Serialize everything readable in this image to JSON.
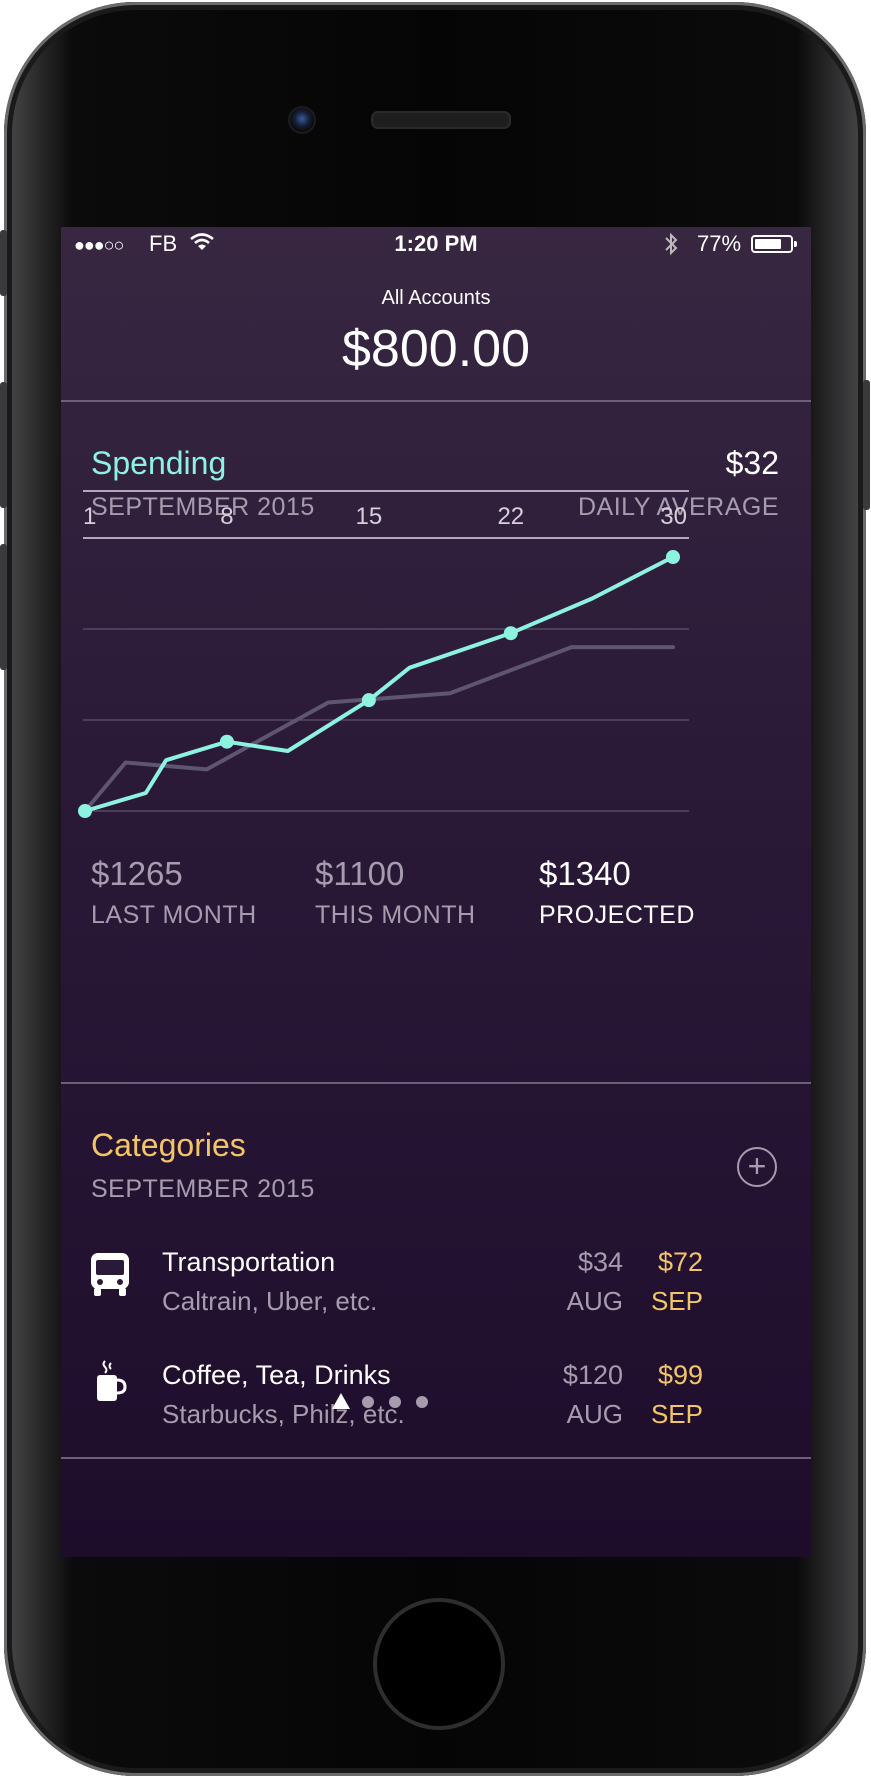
{
  "status_bar": {
    "signal": "●●●○○",
    "carrier": "FB",
    "time": "1:20 PM",
    "battery_percent": "77%",
    "battery_level": 0.77
  },
  "header": {
    "label": "All Accounts",
    "balance": "$800.00"
  },
  "spending": {
    "title": "Spending",
    "period": "SEPTEMBER 2015",
    "daily_average_value": "$32",
    "daily_average_label": "DAILY AVERAGE"
  },
  "chart_data": {
    "type": "line",
    "x_ticks": [
      "1",
      "8",
      "15",
      "22",
      "30"
    ],
    "xlim": [
      1,
      30
    ],
    "grid": true,
    "series": [
      {
        "color": "#8ef2e1",
        "points": [
          [
            1,
            0
          ],
          [
            4,
            78
          ],
          [
            5,
            220
          ],
          [
            8,
            300
          ],
          [
            11,
            260
          ],
          [
            15,
            480
          ],
          [
            17,
            620
          ],
          [
            22,
            770
          ],
          [
            26,
            920
          ],
          [
            30,
            1100
          ]
        ],
        "markers": [
          1,
          8,
          15,
          22,
          30
        ]
      },
      {
        "color": "#5e5670",
        "points": [
          [
            1,
            0
          ],
          [
            3,
            210
          ],
          [
            7,
            180
          ],
          [
            13,
            470
          ],
          [
            19,
            510
          ],
          [
            25,
            710
          ],
          [
            30,
            710
          ]
        ],
        "markers": []
      }
    ],
    "ylim": [
      0,
      1100
    ]
  },
  "summary": [
    {
      "value": "$1265",
      "label": "LAST MONTH",
      "highlight": false
    },
    {
      "value": "$1100",
      "label": "THIS MONTH",
      "highlight": false
    },
    {
      "value": "$1340",
      "label": "PROJECTED",
      "highlight": true
    }
  ],
  "categories": {
    "title": "Categories",
    "period": "SEPTEMBER 2015",
    "items": [
      {
        "icon": "bus-icon",
        "name": "Transportation",
        "desc": "Caltrain, Uber, etc.",
        "aug_value": "$34",
        "aug_label": "AUG",
        "sep_value": "$72",
        "sep_label": "SEP"
      },
      {
        "icon": "coffee-cup-icon",
        "name": "Coffee, Tea, Drinks",
        "desc": "Starbucks, Philz, etc.",
        "aug_value": "$120",
        "aug_label": "AUG",
        "sep_value": "$99",
        "sep_label": "SEP"
      }
    ]
  },
  "colors": {
    "spending_accent": "#8ef2e1",
    "categories_accent": "#f3c567",
    "muted_text": "#a69cae",
    "background_top": "#382741",
    "background_bottom": "#1e0c2b"
  },
  "page_indicator": {
    "count": 4,
    "active": 0
  }
}
